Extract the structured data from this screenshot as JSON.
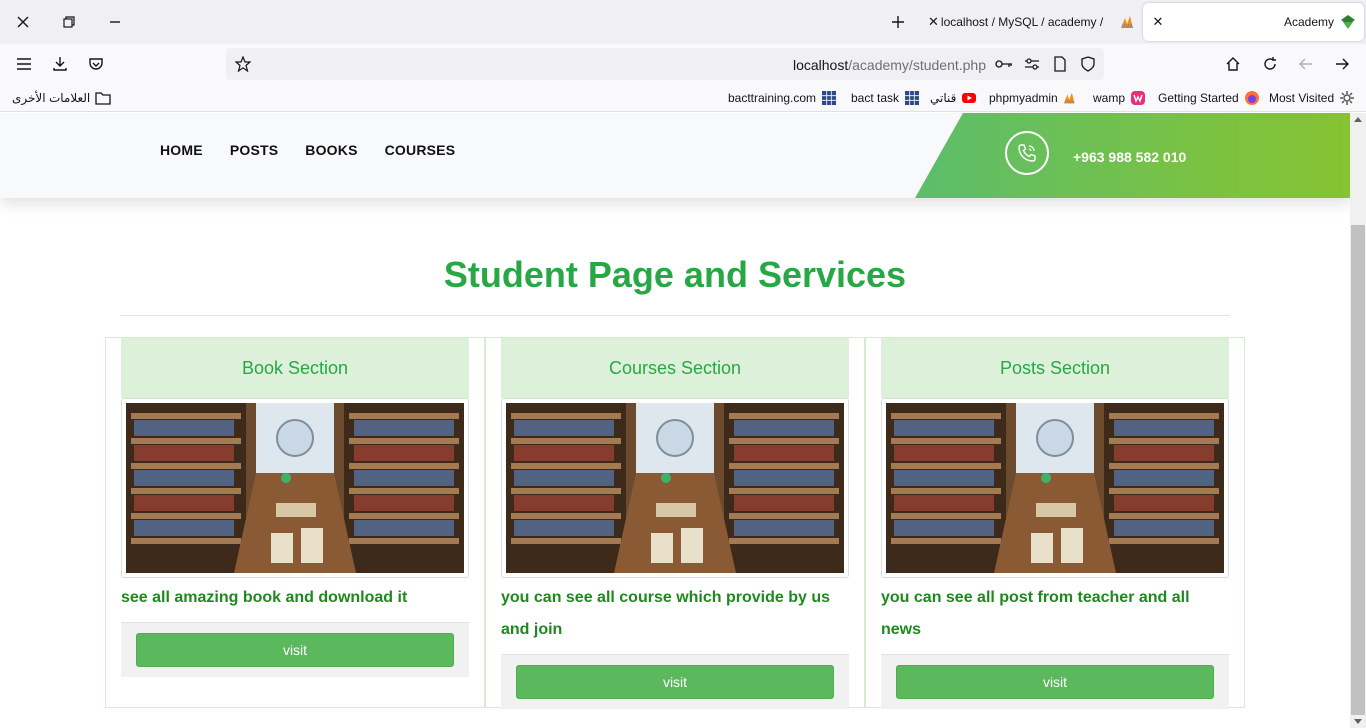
{
  "browser": {
    "tabs": [
      {
        "title": "localhost / MySQL / academy / ",
        "active": false
      },
      {
        "title": "Academy",
        "active": true
      }
    ],
    "address": {
      "host": "localhost",
      "path": "/academy/student.php"
    },
    "bookmarks": [
      {
        "label": "Most Visited",
        "icon": "gear-icon"
      },
      {
        "label": "Getting Started",
        "icon": "firefox-icon"
      },
      {
        "label": "wamp",
        "icon": "wamp-icon"
      },
      {
        "label": "phpmyadmin",
        "icon": "phpmyadmin-icon"
      },
      {
        "label": "قناتي",
        "icon": "youtube-icon"
      },
      {
        "label": "bact task",
        "icon": "grid-icon"
      },
      {
        "label": "bacttraining.com",
        "icon": "grid-icon"
      }
    ],
    "other_bookmarks": "العلامات الأخرى"
  },
  "site": {
    "menu": [
      "HOME",
      "POSTS",
      "BOOKS",
      "COURSES"
    ],
    "phone": "+963 988 582 010",
    "accent_color": "#28a745",
    "button_color": "#5cb85c"
  },
  "main": {
    "title": "Student Page and Services",
    "cards": [
      {
        "heading": "Book Section",
        "text": "see all amazing book and download it",
        "button": "visit"
      },
      {
        "heading": "Courses Section",
        "text": "you can see all course which provide by us and join",
        "button": "visit"
      },
      {
        "heading": "Posts Section",
        "text": "you can see all post from teacher and all news",
        "button": "visit"
      }
    ]
  }
}
